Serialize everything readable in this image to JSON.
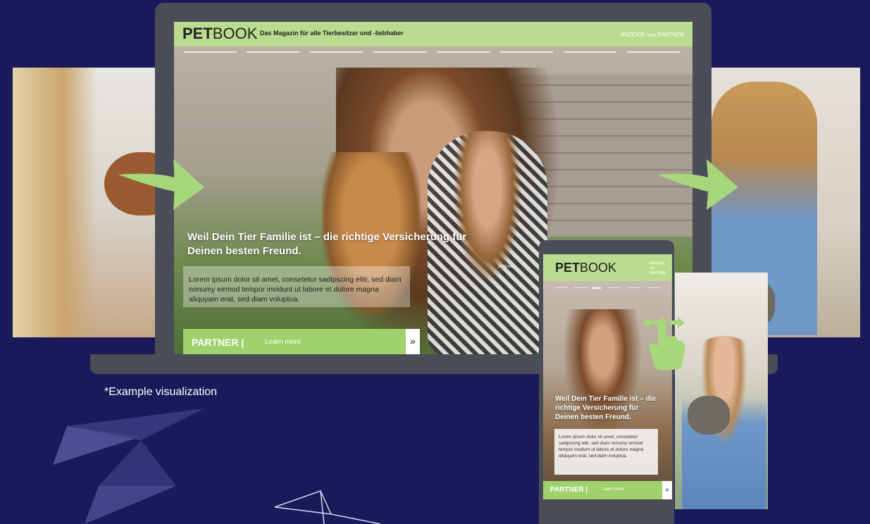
{
  "caption": "*Example visualization",
  "laptop": {
    "logo_bold": "PET",
    "logo_light": "BOOK",
    "tagline": "Das Magazin für alle Tierbesitzer und -liebhaber",
    "ad_label": "ANZEIGE von PARTNER",
    "headline": "Weil Dein Tier Familie ist – die richtige Versicherung für Deinen besten Freund.",
    "teaser": "Lorem ipsum dolor sit amet, consetetur sadipscing elitr, sed diam nonumy eirmod tempor invidunt ut labore et dolore magna aliquyam erat, sed diam voluptua.",
    "ad_badge": "ANZEIGE",
    "cta_partner": "PARTNER |",
    "cta_learn": "Learn more",
    "cta_arrow": "»"
  },
  "phone": {
    "logo_bold": "PET",
    "logo_light": "BOOK",
    "ad_label": "ANZEIGE von PARTNER",
    "headline": "Weil Dein Tier Familie ist – die richtige Versicherung für Deinen besten Freund.",
    "teaser": "Lorem ipsum dolor sit amet, consetetur sadipscing elitr, sed diam nonumy eirmod tempor invidunt ut labore et dolore magna aliquyam erat, sed diam voluptua.",
    "cta_partner": "PARTNER |",
    "cta_learn": "Learn more",
    "cta_arrow": "»"
  },
  "colors": {
    "background": "#1a1a5a",
    "device_frame": "#4a4d57",
    "brand_green": "#b9dc8f",
    "cta_green": "#9fd16c",
    "arrow_green": "#a6d77b"
  }
}
